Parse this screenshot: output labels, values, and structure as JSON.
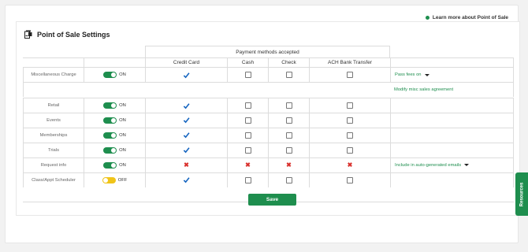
{
  "header": {
    "learn_link": "Learn more about Point of Sale"
  },
  "title": "Point of Sale Settings",
  "table": {
    "group_header": "Payment methods accepted",
    "columns": [
      "Credit Card",
      "Cash",
      "Check",
      "ACH Bank Transfer"
    ]
  },
  "rows": [
    {
      "label": "Miscellaneous Charge",
      "toggle": "ON",
      "methods": [
        "check",
        "box",
        "box",
        "box"
      ],
      "note": "Pass fees on",
      "note_dropdown": true
    },
    {
      "label": "Retail",
      "toggle": "ON",
      "methods": [
        "check",
        "box",
        "box",
        "box"
      ]
    },
    {
      "label": "Events",
      "toggle": "ON",
      "methods": [
        "check",
        "box",
        "box",
        "box"
      ]
    },
    {
      "label": "Memberships",
      "toggle": "ON",
      "methods": [
        "check",
        "box",
        "box",
        "box"
      ]
    },
    {
      "label": "Trials",
      "toggle": "ON",
      "methods": [
        "check",
        "box",
        "box",
        "box"
      ]
    },
    {
      "label": "Request info",
      "toggle": "ON",
      "methods": [
        "x",
        "x",
        "x",
        "x"
      ],
      "note": "Include in auto-generated emails",
      "note_dropdown": true
    },
    {
      "label": "Class/Appt Scheduler",
      "toggle": "OFF",
      "methods": [
        "check",
        "box",
        "box",
        "box"
      ]
    }
  ],
  "misc_link": "Modify misc sales agreement",
  "save_label": "Save",
  "resources_label": "Resources",
  "colors": {
    "accent": "#1e8e4e",
    "off_toggle": "#f0c419",
    "x_mark": "#d9302c",
    "check_mark": "#1565c0"
  }
}
